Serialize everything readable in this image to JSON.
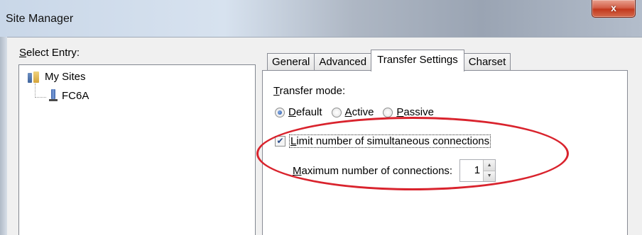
{
  "window": {
    "title": "Site Manager",
    "close_label": "x"
  },
  "left": {
    "select_label": "Select Entry:",
    "tree": [
      {
        "label": "My Sites",
        "icon": "folder-icon"
      },
      {
        "label": "FC6A",
        "icon": "server-icon"
      }
    ]
  },
  "tabs": [
    {
      "label": "General",
      "active": false
    },
    {
      "label": "Advanced",
      "active": false
    },
    {
      "label": "Transfer Settings",
      "active": true
    },
    {
      "label": "Charset",
      "active": false
    }
  ],
  "transfer": {
    "mode_label": "Transfer mode:",
    "options": [
      {
        "label": "Default",
        "checked": true
      },
      {
        "label": "Active",
        "checked": false
      },
      {
        "label": "Passive",
        "checked": false
      }
    ],
    "limit_label": "Limit number of simultaneous connections",
    "limit_checked": true,
    "max_label": "Maximum number of connections:",
    "max_value": "1"
  },
  "colors": {
    "annotation": "#d9232d",
    "title_gradient_light": "#d7e2ef",
    "close_red": "#c2391d"
  }
}
